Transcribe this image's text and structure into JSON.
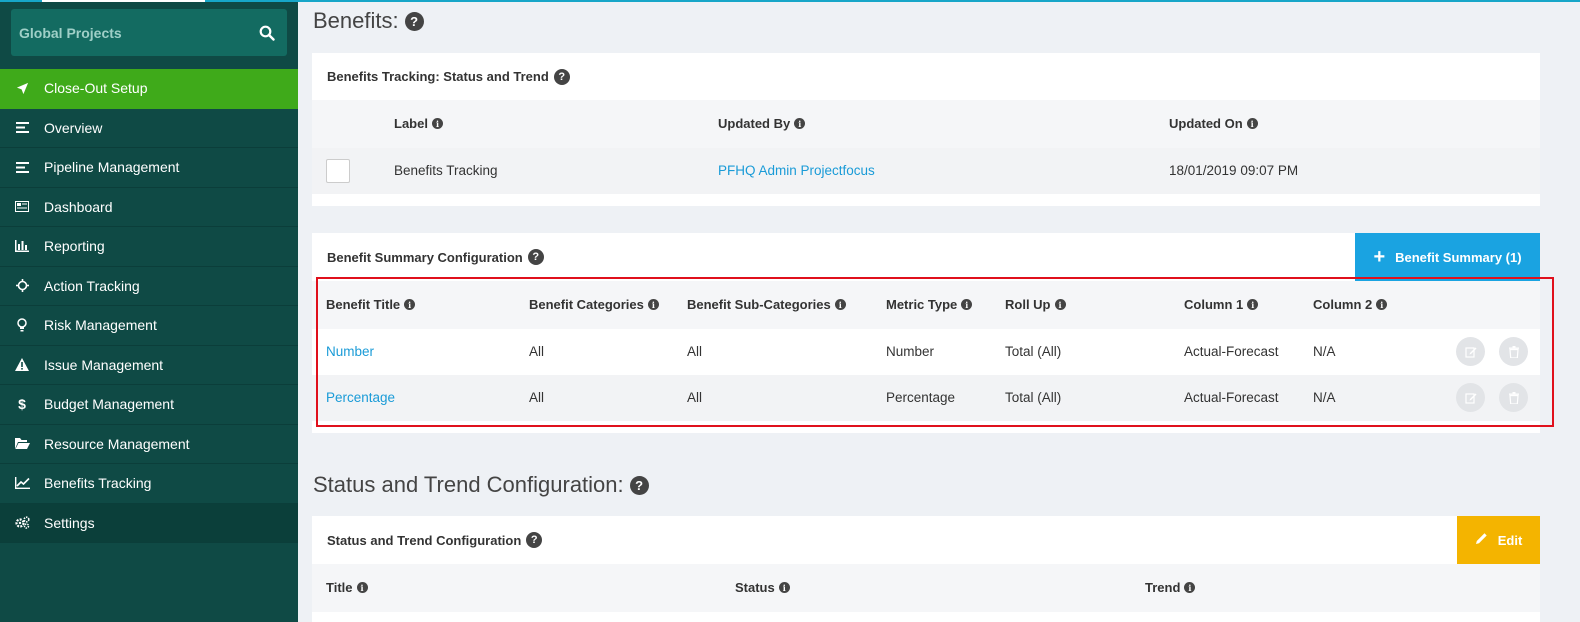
{
  "sidebar": {
    "search_label": "Global Projects",
    "items": [
      {
        "label": "Close-Out Setup",
        "icon": "rocket-icon"
      },
      {
        "label": "Overview",
        "icon": "list-icon"
      },
      {
        "label": "Pipeline Management",
        "icon": "list-icon"
      },
      {
        "label": "Dashboard",
        "icon": "dashboard-icon"
      },
      {
        "label": "Reporting",
        "icon": "bar-chart-icon"
      },
      {
        "label": "Action Tracking",
        "icon": "crosshair-icon"
      },
      {
        "label": "Risk Management",
        "icon": "lightbulb-icon"
      },
      {
        "label": "Issue Management",
        "icon": "warning-icon"
      },
      {
        "label": "Budget Management",
        "icon": "dollar-icon"
      },
      {
        "label": "Resource Management",
        "icon": "folder-icon"
      },
      {
        "label": "Benefits Tracking",
        "icon": "line-chart-icon"
      },
      {
        "label": "Settings",
        "icon": "gears-icon"
      }
    ]
  },
  "benefits": {
    "title": "Benefits:",
    "tracking_panel": {
      "title": "Benefits Tracking: Status and Trend",
      "headers": [
        "Label",
        "Updated By",
        "Updated On"
      ],
      "row": {
        "label": "Benefits Tracking",
        "updated_by": "PFHQ Admin Projectfocus",
        "updated_on": "18/01/2019 09:07 PM"
      }
    },
    "summary_panel": {
      "title": "Benefit Summary Configuration",
      "button_label": "Benefit Summary (1)",
      "headers": [
        "Benefit Title",
        "Benefit Categories",
        "Benefit Sub-Categories",
        "Metric Type",
        "Roll Up",
        "Column 1",
        "Column 2"
      ],
      "rows": [
        {
          "title": "Number",
          "categories": "All",
          "sub_categories": "All",
          "metric_type": "Number",
          "roll_up": "Total (All)",
          "col1": "Actual-Forecast",
          "col2": "N/A"
        },
        {
          "title": "Percentage",
          "categories": "All",
          "sub_categories": "All",
          "metric_type": "Percentage",
          "roll_up": "Total (All)",
          "col1": "Actual-Forecast",
          "col2": "N/A"
        }
      ]
    }
  },
  "status_trend": {
    "title": "Status and Trend Configuration:",
    "panel_title": "Status and Trend Configuration",
    "edit_label": "Edit",
    "headers": [
      "Title",
      "Status",
      "Trend"
    ]
  },
  "colors": {
    "accent_green": "#3faa1a",
    "sidebar_bg": "#0f4a45",
    "link_blue": "#1a9bd7",
    "button_blue": "#1aa3e1",
    "button_yellow": "#f4b400",
    "highlight_red": "#e0101c"
  }
}
